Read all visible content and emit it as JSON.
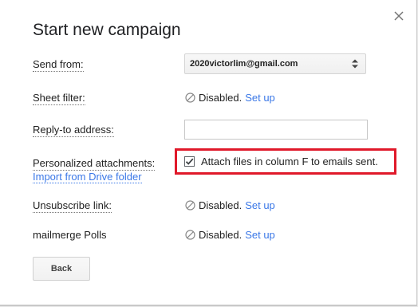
{
  "dialog": {
    "title": "Start new campaign",
    "close_icon": "close-icon"
  },
  "fields": {
    "send_from": {
      "label": "Send from:",
      "selected_value": "2020victorlim@gmail.com"
    },
    "sheet_filter": {
      "label": "Sheet filter:",
      "status": "Disabled.",
      "action": "Set up"
    },
    "reply_to": {
      "label": "Reply-to address:",
      "value": "",
      "placeholder": ""
    },
    "personalized_attachments": {
      "label": "Personalized attachments:",
      "import_link": "Import from Drive folder",
      "checkbox_label": "Attach files in column F to emails sent.",
      "checked": true
    },
    "unsubscribe": {
      "label": "Unsubscribe link:",
      "status": "Disabled.",
      "action": "Set up"
    },
    "polls": {
      "label": "mailmerge Polls",
      "status": "Disabled.",
      "action": "Set up"
    }
  },
  "buttons": {
    "back_label": "Back"
  },
  "colors": {
    "link": "#3b78e7",
    "highlight_border": "#e0192a",
    "text": "#222222"
  }
}
